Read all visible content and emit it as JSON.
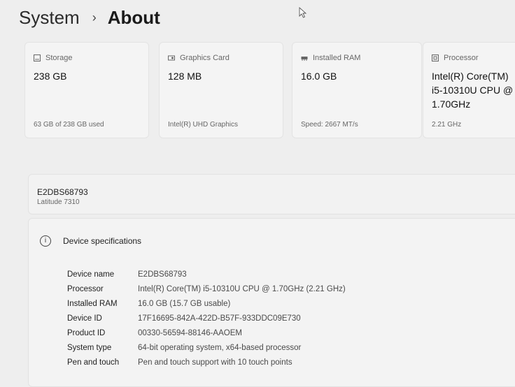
{
  "breadcrumb": {
    "parent": "System",
    "separator": "›",
    "current": "About"
  },
  "cards": [
    {
      "icon": "storage-icon",
      "label": "Storage",
      "value": "238 GB",
      "sub": "63 GB of 238 GB used"
    },
    {
      "icon": "graphics-card-icon",
      "label": "Graphics Card",
      "value": "128 MB",
      "sub": "Intel(R) UHD Graphics"
    },
    {
      "icon": "ram-icon",
      "label": "Installed RAM",
      "value": "16.0 GB",
      "sub": "Speed: 2667 MT/s"
    },
    {
      "icon": "processor-icon",
      "label": "Processor",
      "value": "Intel(R) Core(TM) i5-10310U CPU @ 1.70GHz",
      "sub": "2.21 GHz"
    }
  ],
  "device": {
    "name": "E2DBS68793",
    "model": "Latitude 7310"
  },
  "specs": {
    "title": "Device specifications",
    "rows": [
      {
        "label": "Device name",
        "value": "E2DBS68793"
      },
      {
        "label": "Processor",
        "value": "Intel(R) Core(TM) i5-10310U CPU @ 1.70GHz (2.21 GHz)"
      },
      {
        "label": "Installed RAM",
        "value": "16.0 GB (15.7 GB usable)"
      },
      {
        "label": "Device ID",
        "value": "17F16695-842A-422D-B57F-933DDC09E730"
      },
      {
        "label": "Product ID",
        "value": "00330-56594-88146-AAOEM"
      },
      {
        "label": "System type",
        "value": "64-bit operating system, x64-based processor"
      },
      {
        "label": "Pen and touch",
        "value": "Pen and touch support with 10 touch points"
      }
    ]
  }
}
